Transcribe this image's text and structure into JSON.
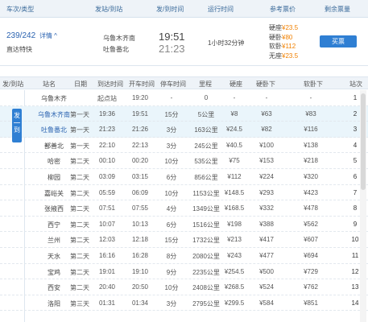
{
  "header": {
    "train_no": "车次/类型",
    "stations": "发站/到站",
    "times": "发/到时间",
    "duration": "运行时间",
    "prices": "参考票价",
    "remaining": "剩余票量"
  },
  "train": {
    "number": "239/242",
    "detail": "详情 ^",
    "type": "直达特快",
    "from": "乌鲁木齐南",
    "to": "吐鲁番北",
    "dep_time": "19:51",
    "arr_time": "21:23",
    "duration": "1小时32分钟",
    "prices": [
      {
        "label": "硬座",
        "value": "¥23.5"
      },
      {
        "label": "硬卧",
        "value": "¥80"
      },
      {
        "label": "软卧",
        "value": "¥112"
      },
      {
        "label": "无座",
        "value": "¥23.5"
      }
    ],
    "buy_label": "买票"
  },
  "table": {
    "headers": {
      "fa_dao": "发/到站",
      "station": "站名",
      "day": "日期",
      "arr": "到达时间",
      "dep": "开车时间",
      "stop": "停车时间",
      "km": "里程",
      "yz": "硬座",
      "yw": "硬卧下",
      "rw": "软卧下",
      "idx": "站次"
    },
    "side_tab": [
      "发",
      "到"
    ],
    "rows": [
      {
        "station": "乌鲁木齐",
        "day": "",
        "arr": "起点站",
        "dep": "19:20",
        "stop": "-",
        "km": "0",
        "yz": "-",
        "yw": "-",
        "rw": "-",
        "idx": "1"
      },
      {
        "station": "乌鲁木齐南",
        "day": "第一天",
        "arr": "19:36",
        "dep": "19:51",
        "stop": "15分",
        "km": "5公里",
        "yz": "¥8",
        "yw": "¥63",
        "rw": "¥83",
        "idx": "2"
      },
      {
        "station": "吐鲁番北",
        "day": "第一天",
        "arr": "21:23",
        "dep": "21:26",
        "stop": "3分",
        "km": "163公里",
        "yz": "¥24.5",
        "yw": "¥82",
        "rw": "¥116",
        "idx": "3"
      },
      {
        "station": "鄯善北",
        "day": "第一天",
        "arr": "22:10",
        "dep": "22:13",
        "stop": "3分",
        "km": "245公里",
        "yz": "¥40.5",
        "yw": "¥100",
        "rw": "¥138",
        "idx": "4"
      },
      {
        "station": "哈密",
        "day": "第二天",
        "arr": "00:10",
        "dep": "00:20",
        "stop": "10分",
        "km": "535公里",
        "yz": "¥75",
        "yw": "¥153",
        "rw": "¥218",
        "idx": "5"
      },
      {
        "station": "柳园",
        "day": "第二天",
        "arr": "03:09",
        "dep": "03:15",
        "stop": "6分",
        "km": "856公里",
        "yz": "¥112",
        "yw": "¥224",
        "rw": "¥320",
        "idx": "6"
      },
      {
        "station": "嘉峪关",
        "day": "第二天",
        "arr": "05:59",
        "dep": "06:09",
        "stop": "10分",
        "km": "1153公里",
        "yz": "¥148.5",
        "yw": "¥293",
        "rw": "¥423",
        "idx": "7"
      },
      {
        "station": "张掖西",
        "day": "第二天",
        "arr": "07:51",
        "dep": "07:55",
        "stop": "4分",
        "km": "1349公里",
        "yz": "¥168.5",
        "yw": "¥332",
        "rw": "¥478",
        "idx": "8"
      },
      {
        "station": "西宁",
        "day": "第二天",
        "arr": "10:07",
        "dep": "10:13",
        "stop": "6分",
        "km": "1516公里",
        "yz": "¥198",
        "yw": "¥388",
        "rw": "¥562",
        "idx": "9"
      },
      {
        "station": "兰州",
        "day": "第二天",
        "arr": "12:03",
        "dep": "12:18",
        "stop": "15分",
        "km": "1732公里",
        "yz": "¥213",
        "yw": "¥417",
        "rw": "¥607",
        "idx": "10"
      },
      {
        "station": "天水",
        "day": "第二天",
        "arr": "16:16",
        "dep": "16:28",
        "stop": "8分",
        "km": "2080公里",
        "yz": "¥243",
        "yw": "¥477",
        "rw": "¥694",
        "idx": "11"
      },
      {
        "station": "宝鸡",
        "day": "第二天",
        "arr": "19:01",
        "dep": "19:10",
        "stop": "9分",
        "km": "2235公里",
        "yz": "¥254.5",
        "yw": "¥500",
        "rw": "¥729",
        "idx": "12"
      },
      {
        "station": "西安",
        "day": "第二天",
        "arr": "20:40",
        "dep": "20:50",
        "stop": "10分",
        "km": "2408公里",
        "yz": "¥268.5",
        "yw": "¥524",
        "rw": "¥762",
        "idx": "13"
      },
      {
        "station": "洛阳",
        "day": "第三天",
        "arr": "01:31",
        "dep": "01:34",
        "stop": "3分",
        "km": "2795公里",
        "yz": "¥299.5",
        "yw": "¥584",
        "rw": "¥851",
        "idx": "14"
      }
    ],
    "highlight_rows": [
      1,
      2
    ],
    "colors": {
      "highlight_station": "#2a62b0",
      "normal_station": "#444444",
      "price": "#f08000"
    }
  }
}
